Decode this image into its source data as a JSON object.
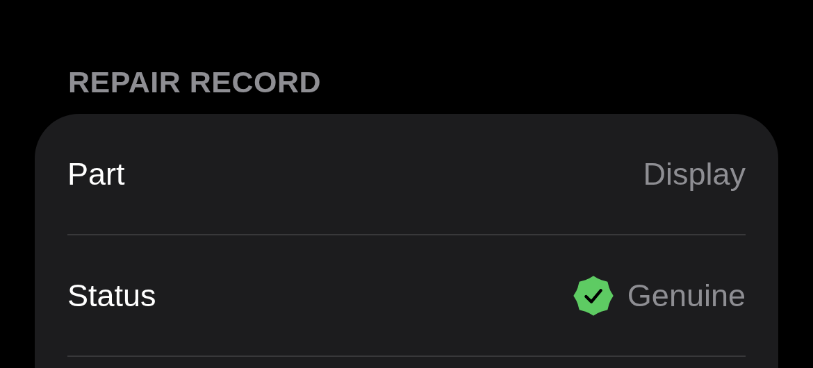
{
  "section": {
    "title": "REPAIR RECORD"
  },
  "rows": [
    {
      "kind": "plain",
      "label": "Part",
      "value": "Display"
    },
    {
      "kind": "verified",
      "label": "Status",
      "value": "Genuine"
    }
  ]
}
